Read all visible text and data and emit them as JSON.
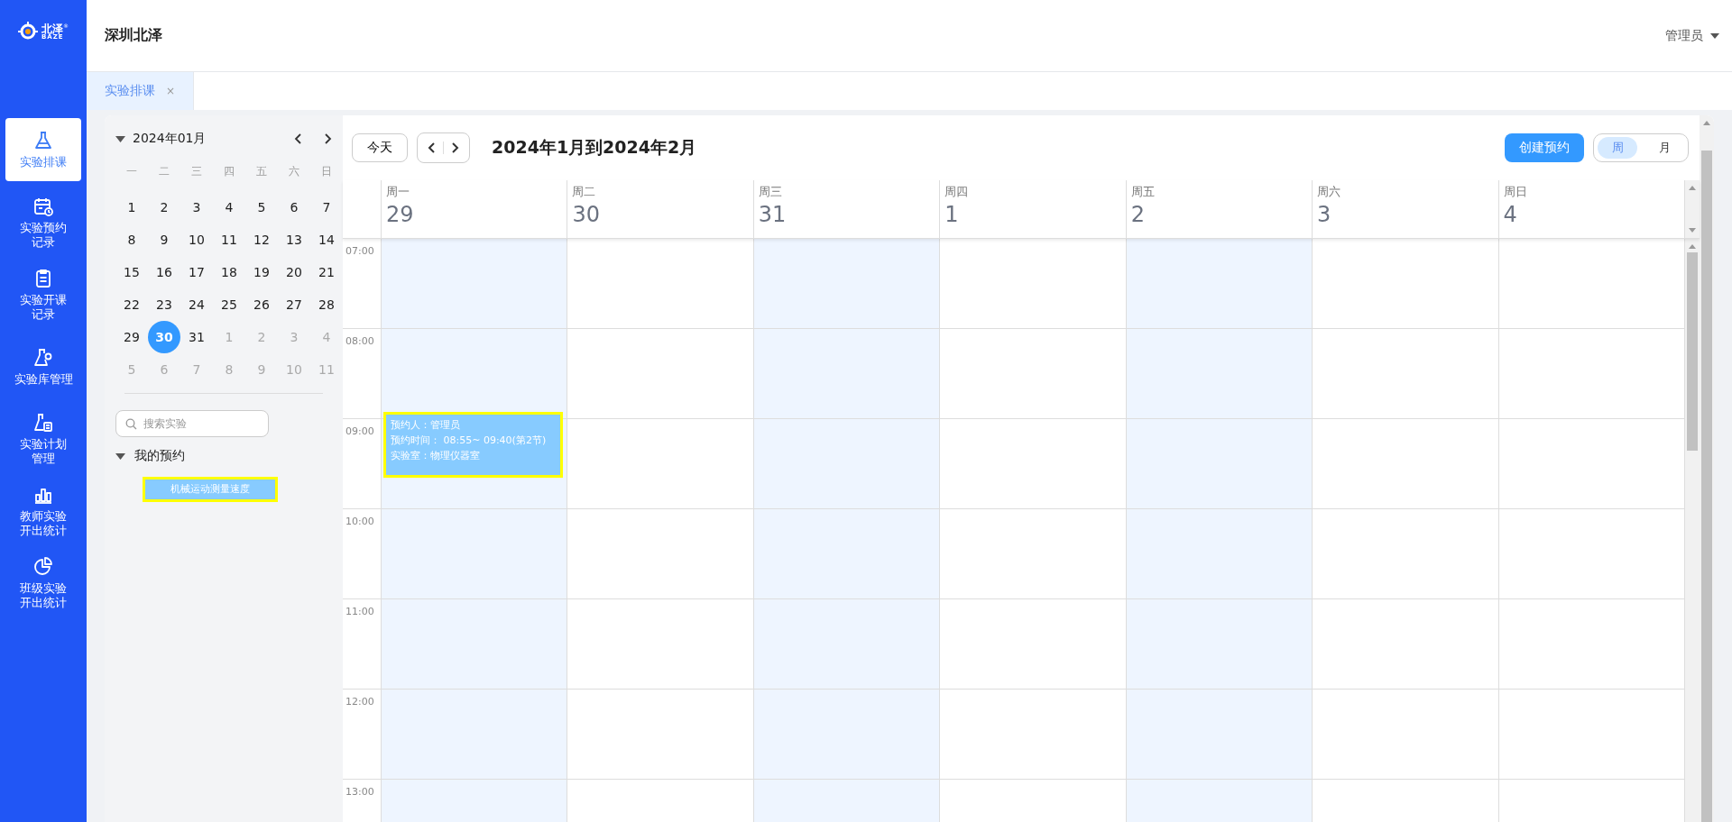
{
  "logo": {
    "name": "北泽",
    "mark": "®",
    "latin": "BAZE"
  },
  "sidebar": {
    "items": [
      {
        "lines": [
          "实验排课"
        ],
        "selected": true
      },
      {
        "lines": [
          "实验预约",
          "记录"
        ],
        "selected": false
      },
      {
        "lines": [
          "实验开课",
          "记录"
        ],
        "selected": false
      },
      {
        "lines": [
          "实验库管理"
        ],
        "selected": false
      },
      {
        "lines": [
          "实验计划",
          "管理"
        ],
        "selected": false
      },
      {
        "lines": [
          "教师实验",
          "开出统计"
        ],
        "selected": false
      },
      {
        "lines": [
          "班级实验",
          "开出统计"
        ],
        "selected": false
      }
    ]
  },
  "header": {
    "title": "深圳北泽",
    "user": "管理员"
  },
  "tabs": [
    {
      "label": "实验排课",
      "selected": true,
      "close": "×"
    }
  ],
  "mini_calendar": {
    "month": "2024年01月",
    "expanded": true,
    "weekdays": [
      "一",
      "二",
      "三",
      "四",
      "五",
      "六",
      "日"
    ],
    "weeks": [
      [
        {
          "label": "1",
          "other_month": false,
          "selected": false
        },
        {
          "label": "2",
          "other_month": false,
          "selected": false
        },
        {
          "label": "3",
          "other_month": false,
          "selected": false
        },
        {
          "label": "4",
          "other_month": false,
          "selected": false
        },
        {
          "label": "5",
          "other_month": false,
          "selected": false
        },
        {
          "label": "6",
          "other_month": false,
          "selected": false
        },
        {
          "label": "7",
          "other_month": false,
          "selected": false
        }
      ],
      [
        {
          "label": "8",
          "other_month": false,
          "selected": false
        },
        {
          "label": "9",
          "other_month": false,
          "selected": false
        },
        {
          "label": "10",
          "other_month": false,
          "selected": false
        },
        {
          "label": "11",
          "other_month": false,
          "selected": false
        },
        {
          "label": "12",
          "other_month": false,
          "selected": false
        },
        {
          "label": "13",
          "other_month": false,
          "selected": false
        },
        {
          "label": "14",
          "other_month": false,
          "selected": false
        }
      ],
      [
        {
          "label": "15",
          "other_month": false,
          "selected": false
        },
        {
          "label": "16",
          "other_month": false,
          "selected": false
        },
        {
          "label": "17",
          "other_month": false,
          "selected": false
        },
        {
          "label": "18",
          "other_month": false,
          "selected": false
        },
        {
          "label": "19",
          "other_month": false,
          "selected": false
        },
        {
          "label": "20",
          "other_month": false,
          "selected": false
        },
        {
          "label": "21",
          "other_month": false,
          "selected": false
        }
      ],
      [
        {
          "label": "22",
          "other_month": false,
          "selected": false
        },
        {
          "label": "23",
          "other_month": false,
          "selected": false
        },
        {
          "label": "24",
          "other_month": false,
          "selected": false
        },
        {
          "label": "25",
          "other_month": false,
          "selected": false
        },
        {
          "label": "26",
          "other_month": false,
          "selected": false
        },
        {
          "label": "27",
          "other_month": false,
          "selected": false
        },
        {
          "label": "28",
          "other_month": false,
          "selected": false
        }
      ],
      [
        {
          "label": "29",
          "other_month": false,
          "selected": false
        },
        {
          "label": "30",
          "other_month": false,
          "selected": true
        },
        {
          "label": "31",
          "other_month": false,
          "selected": false
        },
        {
          "label": "1",
          "other_month": true,
          "selected": false
        },
        {
          "label": "2",
          "other_month": true,
          "selected": false
        },
        {
          "label": "3",
          "other_month": true,
          "selected": false
        },
        {
          "label": "4",
          "other_month": true,
          "selected": false
        }
      ],
      [
        {
          "label": "5",
          "other_month": true,
          "selected": false
        },
        {
          "label": "6",
          "other_month": true,
          "selected": false
        },
        {
          "label": "7",
          "other_month": true,
          "selected": false
        },
        {
          "label": "8",
          "other_month": true,
          "selected": false
        },
        {
          "label": "9",
          "other_month": true,
          "selected": false
        },
        {
          "label": "10",
          "other_month": true,
          "selected": false
        },
        {
          "label": "11",
          "other_month": true,
          "selected": false
        }
      ]
    ]
  },
  "search": {
    "placeholder": "搜索实验"
  },
  "my_bookings": {
    "title": "我的预约",
    "expanded": true,
    "items": [
      {
        "label": "机械运动测量速度",
        "highlighted": true
      }
    ]
  },
  "calendar": {
    "today": "今天",
    "range": "2024年1月到2024年2月",
    "create": "创建预约",
    "views": [
      {
        "label": "周",
        "selected": true
      },
      {
        "label": "月",
        "selected": false
      }
    ],
    "hours": [
      "07:00",
      "08:00",
      "09:00",
      "10:00",
      "11:00",
      "12:00",
      "13:00"
    ],
    "days": [
      {
        "weekday": "周一",
        "date": "29",
        "shaded": true,
        "events": [
          {
            "lines": [
              "预约人：管理员",
              "预约时间：  08:55~ 09:40(第2节)",
              "实验室：物理仪器室"
            ],
            "highlighted": true
          }
        ]
      },
      {
        "weekday": "周二",
        "date": "30",
        "shaded": false
      },
      {
        "weekday": "周三",
        "date": "31",
        "shaded": true
      },
      {
        "weekday": "周四",
        "date": "1",
        "shaded": false
      },
      {
        "weekday": "周五",
        "date": "2",
        "shaded": true
      },
      {
        "weekday": "周六",
        "date": "3",
        "shaded": false
      },
      {
        "weekday": "周日",
        "date": "4",
        "shaded": false
      }
    ]
  }
}
